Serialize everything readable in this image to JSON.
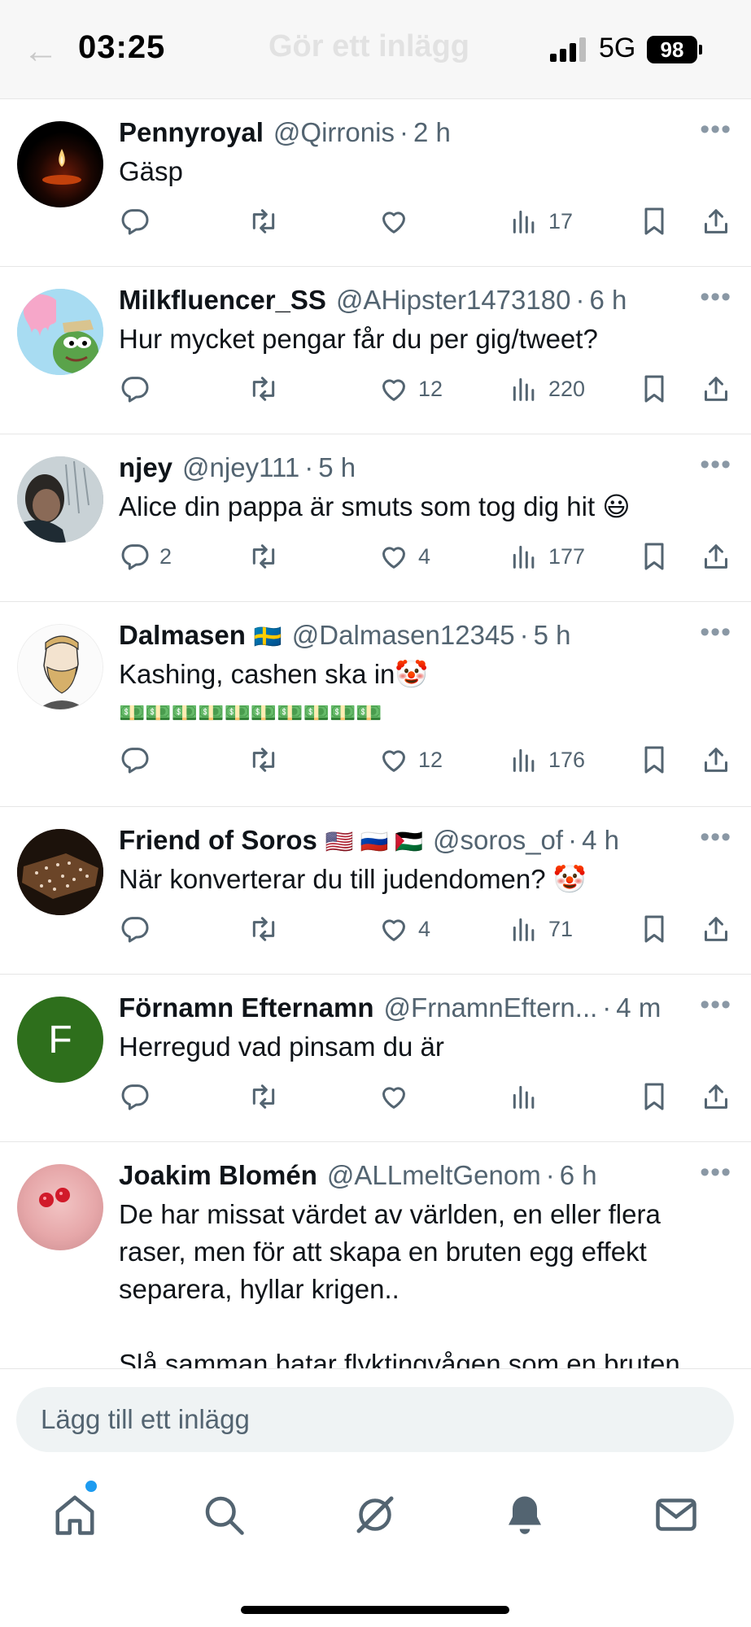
{
  "status_bar": {
    "time": "03:25",
    "network": "5G",
    "battery": "98",
    "underlying_title": "Gör ett inlägg"
  },
  "tweets": [
    {
      "name": "Pennyroyal",
      "flags": "",
      "handle": "@Qirronis",
      "time": "2 h",
      "text": "Gäsp",
      "extra": "",
      "replies": "",
      "retweets": "",
      "likes": "",
      "views": "17",
      "avatar": "candle"
    },
    {
      "name": "Milkfluencer_SS",
      "flags": "",
      "handle": "@AHipster1473180",
      "time": "6 h",
      "text": "Hur mycket pengar får du per gig/tweet?",
      "extra": "",
      "replies": "",
      "retweets": "",
      "likes": "12",
      "views": "220",
      "avatar": "cartoon-frog"
    },
    {
      "name": "njey",
      "flags": "",
      "handle": "@njey111",
      "time": "5 h",
      "text": "Alice din pappa är smuts som tog dig hit 😃",
      "extra": "",
      "replies": "2",
      "retweets": "",
      "likes": "4",
      "views": "177",
      "avatar": "person-photo"
    },
    {
      "name": "Dalmasen",
      "flags": "🇸🇪",
      "handle": "@Dalmasen12345",
      "time": "5 h",
      "text": "Kashing, cashen ska in🤡",
      "extra": "💵💵💵💵💵💵💵💵💵💵",
      "replies": "",
      "retweets": "",
      "likes": "12",
      "views": "176",
      "avatar": "bearded-cartoon"
    },
    {
      "name": "Friend of Soros",
      "flags": "🇺🇸 🇷🇺 🇵🇸",
      "handle": "@soros_of",
      "time": "4 h",
      "text": "När konverterar du till judendomen? 🤡",
      "extra": "",
      "replies": "",
      "retweets": "",
      "likes": "4",
      "views": "71",
      "avatar": "dark-photo"
    },
    {
      "name": "Förnamn Efternamn",
      "flags": "",
      "handle": "@FrnamnEftern...",
      "time": "4 m",
      "text": "Herregud vad pinsam du är",
      "extra": "",
      "replies": "",
      "retweets": "",
      "likes": "",
      "views": "",
      "avatar": "letter-F",
      "avatar_letter": "F",
      "avatar_color": "#2e6f1c"
    },
    {
      "name": "Joakim Blomén",
      "flags": "",
      "handle": "@ALLmeltGenom",
      "time": "6 h",
      "text": "De har missat värdet av världen, en eller flera raser, men för att skapa en bruten egg effekt separera, hyllar krigen..",
      "extra": "Slå samman hatar flyktingvågen som en bruten",
      "replies": "",
      "retweets": "",
      "likes": "",
      "views": "",
      "avatar": "hand-berries"
    }
  ],
  "compose": {
    "placeholder": "Lägg till ett inlägg"
  },
  "tabs": [
    "home",
    "search",
    "grok",
    "notifications",
    "messages"
  ],
  "colors": {
    "accent": "#1d9bf0",
    "secondary_text": "#536471",
    "compose_bg": "#eff3f4"
  }
}
